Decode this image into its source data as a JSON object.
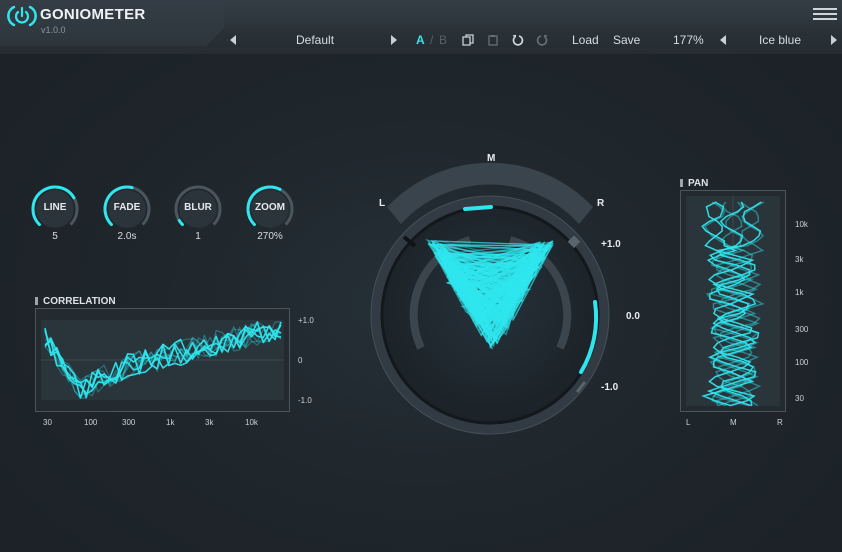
{
  "app": {
    "title": "GONIOMETER",
    "version": "v1.0.0"
  },
  "toolbar": {
    "preset": "Default",
    "ab_a": "A",
    "ab_separator": "/",
    "ab_b": "B",
    "load": "Load",
    "save": "Save",
    "zoom": "177%",
    "theme": "Ice blue"
  },
  "knobs": [
    {
      "label": "LINE",
      "value": "5",
      "level": 0.72
    },
    {
      "label": "FADE",
      "value": "2.0s",
      "level": 0.55
    },
    {
      "label": "BLUR",
      "value": "1",
      "level": 0.05
    },
    {
      "label": "ZOOM",
      "value": "270%",
      "level": 0.6
    }
  ],
  "correlation": {
    "title": "CORRELATION",
    "y_labels": [
      "+1.0",
      "0",
      "-1.0"
    ],
    "x_labels": [
      "30",
      "100",
      "300",
      "1k",
      "3k",
      "10k"
    ]
  },
  "goniometer": {
    "labels": {
      "mid": "M",
      "left": "L",
      "right": "R"
    },
    "scale": [
      "+1.0",
      "0.0",
      "-1.0"
    ]
  },
  "pan": {
    "title": "PAN",
    "y_labels": [
      "10k",
      "3k",
      "1k",
      "300",
      "100",
      "30"
    ],
    "x_labels": [
      "L",
      "M",
      "R"
    ]
  },
  "colors": {
    "accent": "#2fe6ee",
    "background": "#1f262c",
    "panel": "#2a3238"
  }
}
